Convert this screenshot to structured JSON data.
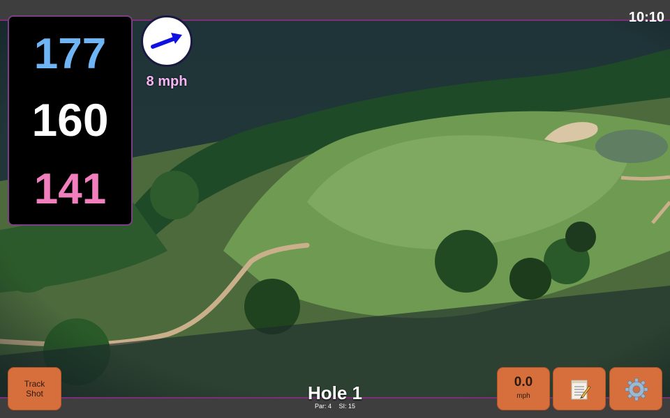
{
  "status": {
    "time": "10:10"
  },
  "yardages": {
    "back": "177",
    "middle": "160",
    "front": "141"
  },
  "wind": {
    "speed": "8 mph",
    "icon": "wind-direction-arrow-icon"
  },
  "track_shot": {
    "line1": "Track",
    "line2": "Shot"
  },
  "hole": {
    "title": "Hole 1",
    "par": "Par: 4",
    "si": "SI: 15"
  },
  "speed": {
    "value": "0.0",
    "unit": "mph"
  },
  "icons": {
    "notes": "notepad-icon",
    "settings": "gear-icon"
  },
  "colors": {
    "accent": "#7b2f78",
    "button": "#d66f3c",
    "back_yardage": "#6fb4f4",
    "front_yardage": "#f27fbd",
    "wind_text": "#f6b6f4"
  }
}
